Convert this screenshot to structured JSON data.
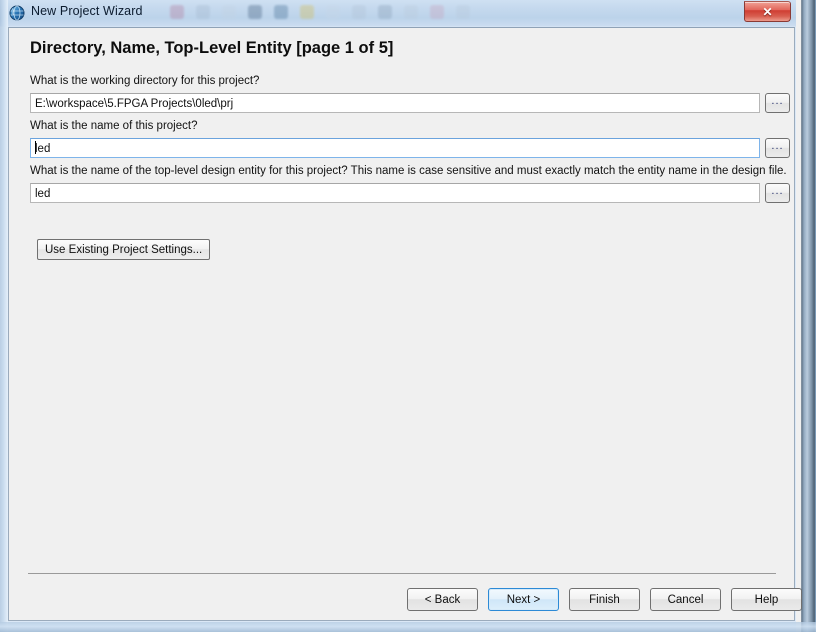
{
  "window": {
    "title": "New Project Wizard",
    "icon": "quartus-globe-icon",
    "close_label": "✕"
  },
  "page": {
    "title": "Directory, Name, Top-Level Entity [page 1 of 5]"
  },
  "fields": [
    {
      "label": "What is the working directory for this project?",
      "value": "E:\\workspace\\5.FPGA Projects\\0led\\prj",
      "placeholder": "",
      "browse_label": "...",
      "focused": false
    },
    {
      "label": "What is the name of this project?",
      "value": "led",
      "placeholder": "",
      "browse_label": "...",
      "focused": true
    },
    {
      "label": "What is the name of the top-level design entity for this project? This name is case sensitive and must exactly match the entity name in the design file.",
      "value": "led",
      "placeholder": "",
      "browse_label": "...",
      "focused": false
    }
  ],
  "use_existing": {
    "label": "Use Existing Project Settings..."
  },
  "footer": {
    "buttons": [
      {
        "label": "< Back",
        "default": false
      },
      {
        "label": "Next >",
        "default": true
      },
      {
        "label": "Finish",
        "default": false
      },
      {
        "label": "Cancel",
        "default": false
      },
      {
        "label": "Help",
        "default": false
      }
    ]
  },
  "colors": {
    "dialog_bg": "#f0f0f0",
    "close_red": "#cf3d32",
    "focus_blue": "#2c8ad6",
    "title_text": "#0b1b2e"
  }
}
